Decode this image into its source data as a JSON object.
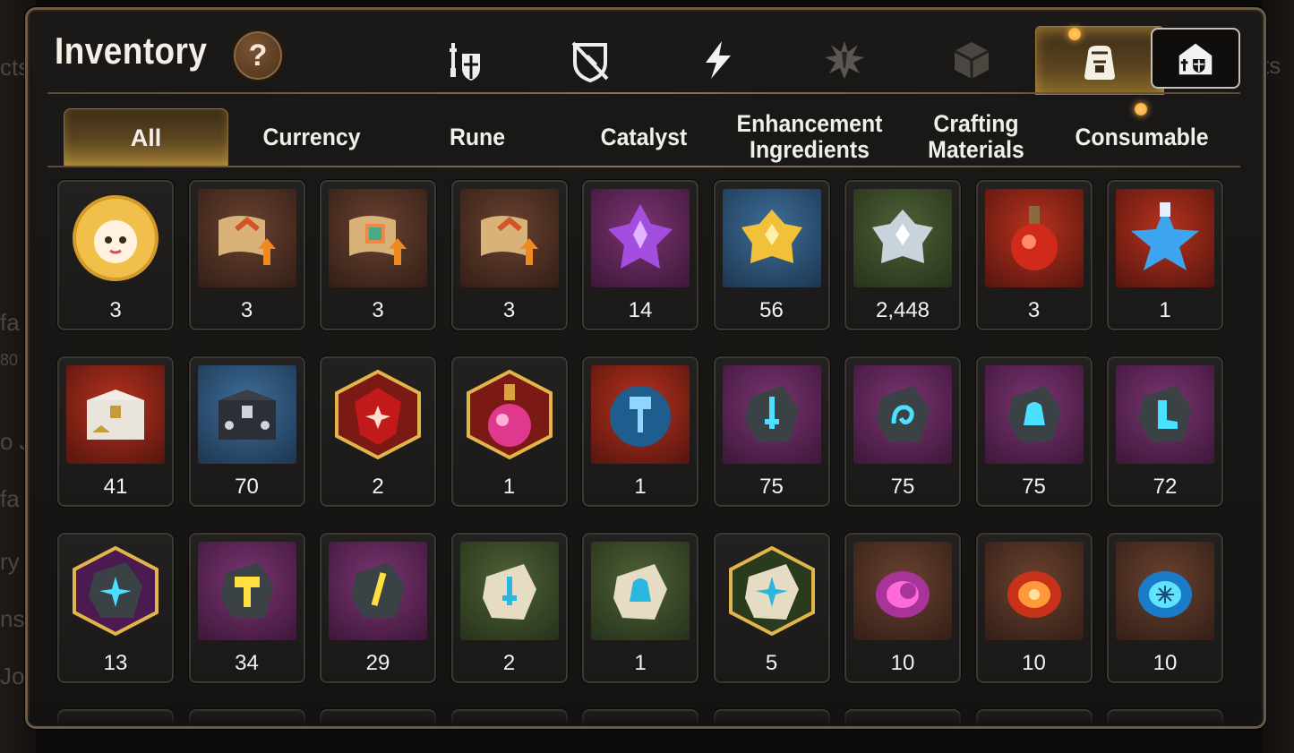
{
  "window": {
    "title": "Inventory",
    "help_label": "?"
  },
  "background_left_text": [
    "cts",
    "fa",
    "80",
    "o J",
    "fa",
    "ry",
    "ns",
    "Jo"
  ],
  "background_right_text": [
    "ts"
  ],
  "category_icons": [
    {
      "name": "gear-equipment-icon",
      "active": false,
      "dim": false
    },
    {
      "name": "artifact-shield-icon",
      "active": false,
      "dim": false
    },
    {
      "name": "lightning-icon",
      "active": false,
      "dim": false
    },
    {
      "name": "splash-emblem-icon",
      "active": false,
      "dim": true
    },
    {
      "name": "cube-icon",
      "active": false,
      "dim": true
    },
    {
      "name": "bag-icon",
      "active": true,
      "dim": false
    }
  ],
  "guild_button": {
    "icon": "guild-castle-icon"
  },
  "tabs": [
    {
      "label": "All",
      "active": true
    },
    {
      "label": "Currency",
      "active": false
    },
    {
      "label": "Rune",
      "active": false
    },
    {
      "label": "Catalyst",
      "active": false
    },
    {
      "label": "Enhancement\nIngredients",
      "active": false
    },
    {
      "label": "Crafting\nMaterials",
      "active": false
    },
    {
      "label": "Consumable",
      "active": false,
      "notification": true
    }
  ],
  "items": [
    {
      "qty": "3",
      "icon": "hero-portrait-icon",
      "bg": "round"
    },
    {
      "qty": "3",
      "icon": "scroll-upgrade-icon",
      "bg": "brown"
    },
    {
      "qty": "3",
      "icon": "rainbow-scroll-upgrade-icon",
      "bg": "brown"
    },
    {
      "qty": "3",
      "icon": "scroll-upgrade-icon",
      "bg": "brown"
    },
    {
      "qty": "14",
      "icon": "purple-crystal-icon",
      "bg": "purple"
    },
    {
      "qty": "56",
      "icon": "gold-crystal-icon",
      "bg": "blue"
    },
    {
      "qty": "2,448",
      "icon": "silver-crystal-icon",
      "bg": "green"
    },
    {
      "qty": "3",
      "icon": "red-potion-icon",
      "bg": "red"
    },
    {
      "qty": "1",
      "icon": "blue-star-potion-icon",
      "bg": "red"
    },
    {
      "qty": "41",
      "icon": "gold-chest-icon",
      "bg": "red"
    },
    {
      "qty": "70",
      "icon": "silver-chest-icon",
      "bg": "blue"
    },
    {
      "qty": "2",
      "icon": "red-gem-icon",
      "bg": "hex-red"
    },
    {
      "qty": "1",
      "icon": "pink-potion-icon",
      "bg": "hex-red"
    },
    {
      "qty": "1",
      "icon": "hammer-rune-icon",
      "bg": "red"
    },
    {
      "qty": "75",
      "icon": "sword-stone-icon",
      "bg": "purple"
    },
    {
      "qty": "75",
      "icon": "spiral-stone-icon",
      "bg": "purple"
    },
    {
      "qty": "75",
      "icon": "bell-stone-icon",
      "bg": "purple"
    },
    {
      "qty": "72",
      "icon": "boot-stone-icon",
      "bg": "purple"
    },
    {
      "qty": "13",
      "icon": "star-stone-icon",
      "bg": "hex-purple"
    },
    {
      "qty": "34",
      "icon": "hammer-stone-icon",
      "bg": "purple"
    },
    {
      "qty": "29",
      "icon": "feather-stone-icon",
      "bg": "purple"
    },
    {
      "qty": "2",
      "icon": "sword-rock-icon",
      "bg": "green"
    },
    {
      "qty": "1",
      "icon": "bell-rock-icon",
      "bg": "green"
    },
    {
      "qty": "5",
      "icon": "star-rock-icon",
      "bg": "hex-green"
    },
    {
      "qty": "10",
      "icon": "moon-orb-icon",
      "bg": "brown"
    },
    {
      "qty": "10",
      "icon": "fire-orb-icon",
      "bg": "brown"
    },
    {
      "qty": "10",
      "icon": "ice-orb-icon",
      "bg": "brown"
    }
  ],
  "colors": {
    "accent_gold": "#a07f36",
    "panel_border": "#6b5a45",
    "bg_purple": "#5a2450",
    "bg_blue": "#284b6e",
    "bg_green": "#36472a",
    "bg_red": "#7a1e16",
    "bg_brown": "#4b2e22"
  }
}
